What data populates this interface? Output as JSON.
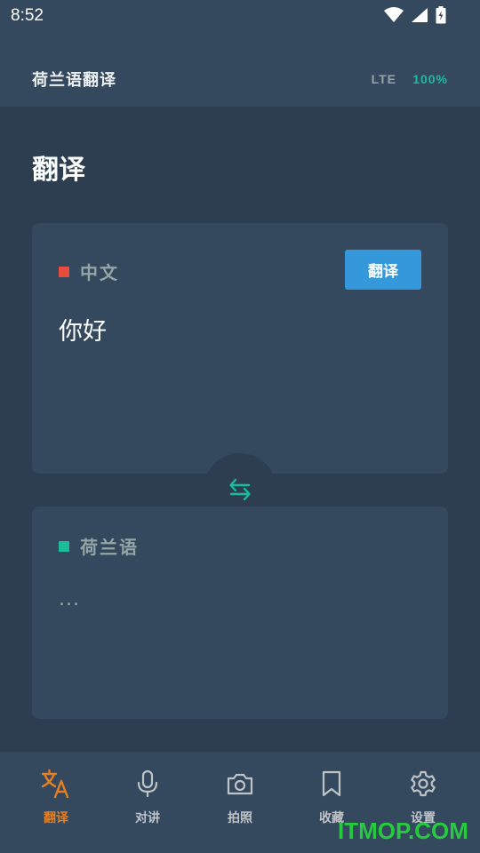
{
  "status": {
    "time": "8:52"
  },
  "app": {
    "title": "荷兰语翻译",
    "network": "LTE",
    "battery": "100%"
  },
  "page": {
    "title": "翻译"
  },
  "source": {
    "language": "中文",
    "language_color": "#e74c3c",
    "text": "你好",
    "button_label": "翻译"
  },
  "target": {
    "language": "荷兰语",
    "language_color": "#1abc9c",
    "text": "..."
  },
  "nav": {
    "items": [
      {
        "label": "翻译",
        "icon": "translate-icon",
        "active": true
      },
      {
        "label": "对讲",
        "icon": "microphone-icon"
      },
      {
        "label": "拍照",
        "icon": "camera-icon"
      },
      {
        "label": "收藏",
        "icon": "bookmark-icon"
      },
      {
        "label": "设置",
        "icon": "settings-icon"
      }
    ]
  },
  "colors": {
    "accent_active": "#e67e22",
    "button": "#3498db",
    "swap": "#1abc9c"
  },
  "watermark": "ITMOP.COM"
}
